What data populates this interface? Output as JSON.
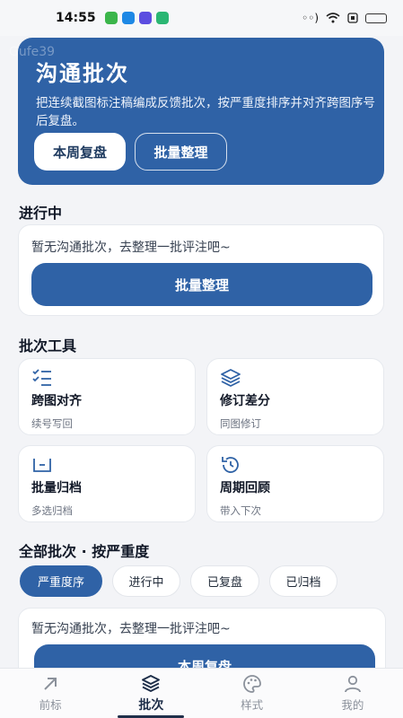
{
  "status_bar": {
    "time": "14:55"
  },
  "watermark": "Gufe39",
  "hero": {
    "title": "沟通批次",
    "description": "把连续截图标注稿编成反馈批次，按严重度排序并对齐跨图序号后复盘。",
    "primary_button": "本周复盘",
    "secondary_button": "批量整理"
  },
  "in_progress": {
    "title": "进行中",
    "empty_text": "暂无沟通批次，去整理一批评注吧~",
    "button": "批量整理"
  },
  "tools": {
    "title": "批次工具",
    "items": [
      {
        "name": "跨图对齐",
        "sub": "续号写回",
        "icon": "list-check-icon"
      },
      {
        "name": "修订差分",
        "sub": "同图修订",
        "icon": "layers-icon"
      },
      {
        "name": "批量归档",
        "sub": "多选归档",
        "icon": "archive-tray-icon"
      },
      {
        "name": "周期回顾",
        "sub": "带入下次",
        "icon": "history-icon"
      }
    ]
  },
  "all_batches": {
    "title": "全部批次 · 按严重度",
    "filters": [
      "严重度序",
      "进行中",
      "已复盘",
      "已归档"
    ],
    "active_filter": 0,
    "empty_text": "暂无沟通批次，去整理一批评注吧~",
    "button": "本周复盘"
  },
  "bottom_nav": {
    "items": [
      {
        "label": "前标",
        "icon": "arrow-up-right-icon"
      },
      {
        "label": "批次",
        "icon": "layers-icon"
      },
      {
        "label": "样式",
        "icon": "palette-icon"
      },
      {
        "label": "我的",
        "icon": "user-icon"
      }
    ],
    "active": 1
  },
  "colors": {
    "primary": "#2f62a6",
    "background": "#f3f4f7",
    "nav_active": "#1f2f4a"
  }
}
